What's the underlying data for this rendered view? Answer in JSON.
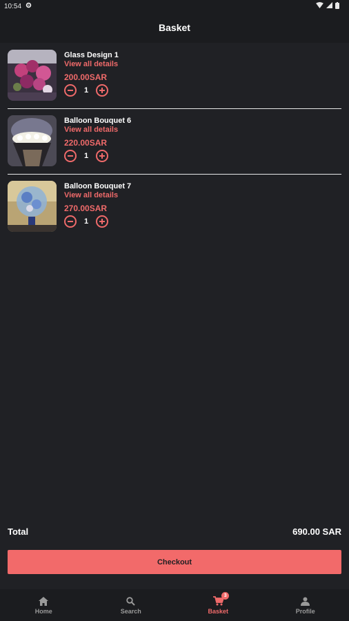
{
  "status_bar": {
    "time": "10:54"
  },
  "app_bar": {
    "title": "Basket"
  },
  "items": [
    {
      "name": "Glass Design 1",
      "details_link": "View all details",
      "price": "200.00SAR",
      "quantity": "1"
    },
    {
      "name": "Balloon Bouquet 6",
      "details_link": "View all details",
      "price": "220.00SAR",
      "quantity": "1"
    },
    {
      "name": "Balloon Bouquet 7",
      "details_link": "View all details",
      "price": "270.00SAR",
      "quantity": "1"
    }
  ],
  "summary": {
    "total_label": "Total",
    "total_value": "690.00 SAR"
  },
  "checkout": {
    "label": "Checkout"
  },
  "bottom_nav": {
    "items": [
      {
        "label": "Home",
        "icon": "home-icon"
      },
      {
        "label": "Search",
        "icon": "search-icon"
      },
      {
        "label": "Basket",
        "icon": "cart-icon",
        "badge": "3"
      },
      {
        "label": "Profile",
        "icon": "profile-icon"
      }
    ],
    "active": "Basket"
  },
  "colors": {
    "accent": "#ef6a6a",
    "background": "#202125",
    "bar": "#1b1c1f"
  }
}
